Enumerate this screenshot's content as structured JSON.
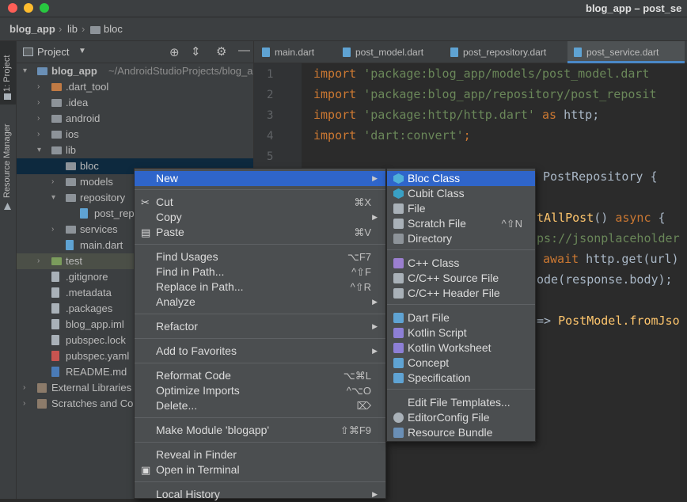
{
  "window": {
    "title": "blog_app – post_se"
  },
  "breadcrumb": {
    "project": "blog_app",
    "sep": "›",
    "lib": "lib",
    "bloc": "bloc"
  },
  "side_tabs": {
    "project": "1: Project",
    "resource_manager": "Resource Manager"
  },
  "project_panel": {
    "title": "Project",
    "tree": [
      {
        "label": "blog_app",
        "path": "~/AndroidStudioProjects/blog_a",
        "arrow": "▾",
        "icon": "flutter-project-icon"
      },
      {
        "label": ".dart_tool",
        "arrow": "›",
        "icon": "folder-icon"
      },
      {
        "label": ".idea",
        "arrow": "›",
        "icon": "folder-icon"
      },
      {
        "label": "android",
        "arrow": "›",
        "icon": "folder-icon"
      },
      {
        "label": "ios",
        "arrow": "›",
        "icon": "folder-icon"
      },
      {
        "label": "lib",
        "arrow": "▾",
        "icon": "folder-icon"
      },
      {
        "label": "bloc",
        "arrow": "",
        "icon": "folder-icon"
      },
      {
        "label": "models",
        "arrow": "›",
        "icon": "folder-icon"
      },
      {
        "label": "repository",
        "arrow": "▾",
        "icon": "folder-icon"
      },
      {
        "label": "post_rep",
        "arrow": "",
        "icon": "dart-file-icon"
      },
      {
        "label": "services",
        "arrow": "›",
        "icon": "folder-icon"
      },
      {
        "label": "main.dart",
        "arrow": "",
        "icon": "dart-file-icon"
      },
      {
        "label": "test",
        "arrow": "›",
        "icon": "test-folder-icon"
      },
      {
        "label": ".gitignore",
        "arrow": "",
        "icon": "file-icon"
      },
      {
        "label": ".metadata",
        "arrow": "",
        "icon": "file-icon"
      },
      {
        "label": ".packages",
        "arrow": "",
        "icon": "file-icon"
      },
      {
        "label": "blog_app.iml",
        "arrow": "",
        "icon": "file-icon"
      },
      {
        "label": "pubspec.lock",
        "arrow": "",
        "icon": "file-icon"
      },
      {
        "label": "pubspec.yaml",
        "arrow": "",
        "icon": "yaml-file-icon"
      },
      {
        "label": "README.md",
        "arrow": "",
        "icon": "markdown-file-icon"
      },
      {
        "label": "External Libraries",
        "arrow": "›",
        "icon": "library-icon"
      },
      {
        "label": "Scratches and Co",
        "arrow": "›",
        "icon": "scratches-icon"
      }
    ]
  },
  "editor": {
    "tabs": [
      "main.dart",
      "post_model.dart",
      "post_repository.dart",
      "post_service.dart"
    ],
    "active_tab": "post_service.dart",
    "line_numbers": [
      "1",
      "2",
      "3",
      "4",
      "5"
    ],
    "code": {
      "l1_kw": "import",
      "l1_str": " 'package:blog_app/models/post_model.dart",
      "l2_kw": "import",
      "l2_str": " 'package:blog_app/repository/post_reposit",
      "l3_kw": "import",
      "l3_str": " 'package:http/http.dart'",
      "l3_as": " as",
      "l3_rest": " http;",
      "l4_kw": "import",
      "l4_str": " 'dart:convert'",
      "l4_rest": ";",
      "l6": "PostRepository {",
      "l7_fn": "tAllPost",
      "l7_rest": "() ",
      "l7_kw": "async",
      "l7_end": " {",
      "l8_str": "ps://jsonplaceholder",
      "l9_kw": "await",
      "l9_rest": " http.get(url)",
      "l10": "ode(response.body);",
      "l12_arrow": "=> ",
      "l12_fn": "PostModel.fromJso"
    }
  },
  "context_menu": {
    "items": [
      {
        "label": "New",
        "shortcut": "",
        "submenu": true
      },
      {
        "label": "Cut",
        "shortcut": "⌘X",
        "icon": "cut-icon"
      },
      {
        "label": "Copy",
        "shortcut": "",
        "submenu": true
      },
      {
        "label": "Paste",
        "shortcut": "⌘V",
        "icon": "paste-icon"
      },
      {
        "label": "Find Usages",
        "shortcut": "⌥F7"
      },
      {
        "label": "Find in Path...",
        "shortcut": "^⇧F"
      },
      {
        "label": "Replace in Path...",
        "shortcut": "^⇧R"
      },
      {
        "label": "Analyze",
        "shortcut": "",
        "submenu": true
      },
      {
        "label": "Refactor",
        "shortcut": "",
        "submenu": true
      },
      {
        "label": "Add to Favorites",
        "shortcut": "",
        "submenu": true
      },
      {
        "label": "Reformat Code",
        "shortcut": "⌥⌘L"
      },
      {
        "label": "Optimize Imports",
        "shortcut": "^⌥O"
      },
      {
        "label": "Delete...",
        "shortcut": "⌦"
      },
      {
        "label": "Make Module 'blogapp'",
        "shortcut": "⇧⌘F9"
      },
      {
        "label": "Reveal in Finder",
        "shortcut": ""
      },
      {
        "label": "Open in Terminal",
        "shortcut": "",
        "icon": "terminal-icon"
      },
      {
        "label": "Local History",
        "shortcut": "",
        "submenu": true
      }
    ]
  },
  "new_submenu": {
    "items": [
      {
        "label": "Bloc Class",
        "icon": "bloc-icon",
        "color": "#4fb0d8"
      },
      {
        "label": "Cubit Class",
        "icon": "cubit-icon",
        "color": "#39a0c4"
      },
      {
        "label": "File",
        "icon": "file-icon",
        "color": "#a9b1b8"
      },
      {
        "label": "Scratch File",
        "shortcut": "^⇧N",
        "icon": "scratch-file-icon",
        "color": "#a9b1b8"
      },
      {
        "label": "Directory",
        "icon": "folder-icon",
        "color": "#8d9399"
      },
      {
        "label": "C++ Class",
        "icon": "cpp-class-icon",
        "color": "#9b7fd0"
      },
      {
        "label": "C/C++ Source File",
        "icon": "cpp-source-icon",
        "color": "#a9b1b8"
      },
      {
        "label": "C/C++ Header File",
        "icon": "cpp-header-icon",
        "color": "#a9b1b8"
      },
      {
        "label": "Dart File",
        "icon": "dart-file-icon",
        "color": "#5fa3d3"
      },
      {
        "label": "Kotlin Script",
        "icon": "kotlin-icon",
        "color": "#8d7fd6"
      },
      {
        "label": "Kotlin Worksheet",
        "icon": "kotlin-icon",
        "color": "#8d7fd6"
      },
      {
        "label": "Concept",
        "icon": "concept-icon",
        "color": "#5fa3d3"
      },
      {
        "label": "Specification",
        "icon": "specification-icon",
        "color": "#5fa3d3"
      },
      {
        "label": "Edit File Templates...",
        "icon": ""
      },
      {
        "label": "EditorConfig File",
        "icon": "gear-icon",
        "color": "#a9b1b8"
      },
      {
        "label": "Resource Bundle",
        "icon": "resource-bundle-icon",
        "color": "#6a8fb6"
      }
    ]
  },
  "colors": {
    "accent": "#2f65ca",
    "selection": "#0d293e",
    "keyword": "#cc7832",
    "string": "#6a8759"
  }
}
